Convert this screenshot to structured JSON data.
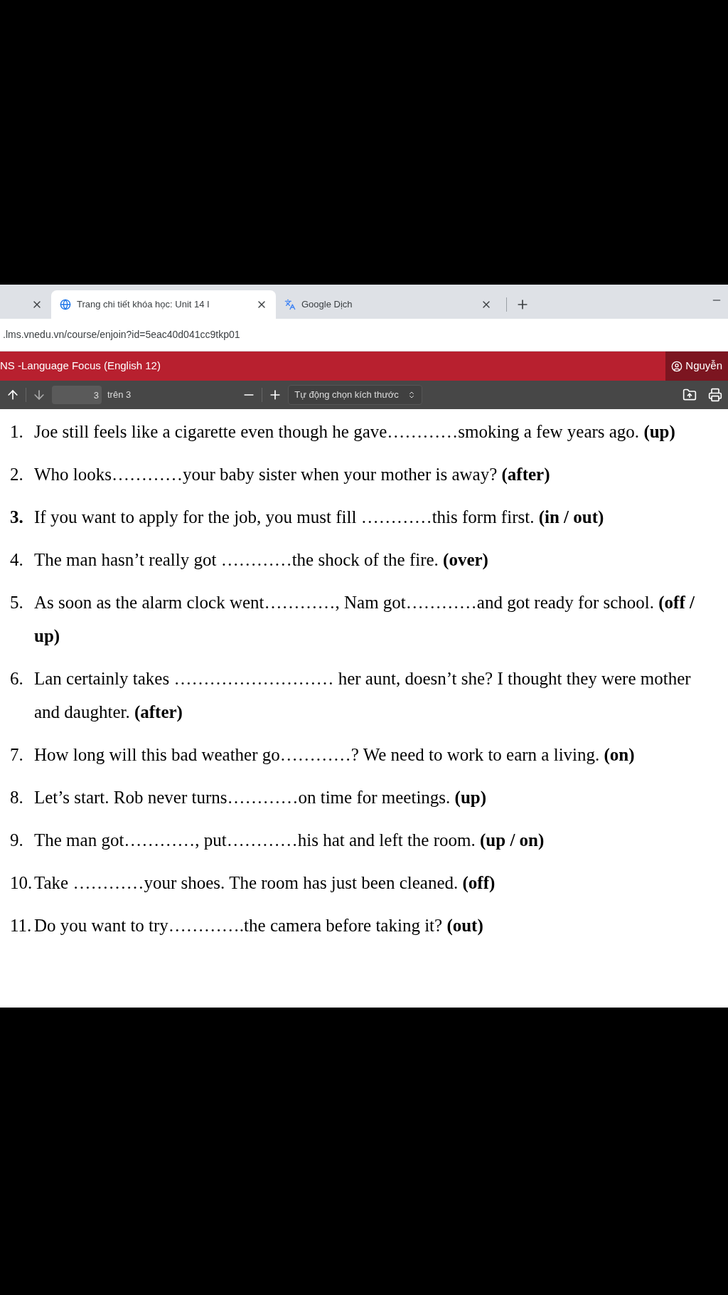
{
  "browser": {
    "tabs": [
      {
        "selected": false
      },
      {
        "title": "Trang chi tiết khóa học: Unit 14 I",
        "selected": true
      },
      {
        "title": "Google Dịch",
        "selected": false
      }
    ],
    "address": ".lms.vnedu.vn/course/enjoin?id=5eac40d041cc9tkp01"
  },
  "site_header": {
    "title": "NS -Language Focus (English 12)",
    "user": "Nguyễn"
  },
  "pdf_toolbar": {
    "page": "3",
    "page_count": "trên 3",
    "zoom": "Tự động chọn kích thước"
  },
  "exercises": [
    {
      "number": "1.",
      "number_bold": false,
      "text": "Joe still feels like a cigarette even though he gave…………smoking a few years ago. **(up)**"
    },
    {
      "number": "2.",
      "number_bold": false,
      "text": "Who looks…………your baby sister when your mother is away? **(after)**"
    },
    {
      "number": "3.",
      "number_bold": true,
      "text": "If you want to apply for the job, you must fill …………this form first. **(in / out)**"
    },
    {
      "number": "4.",
      "number_bold": false,
      "text": "The man hasn’t really got …………the shock of the fire. **(over)**"
    },
    {
      "number": "5.",
      "number_bold": false,
      "text": "As soon as the alarm clock went…………, Nam got…………and got ready for school. **(off / up)**"
    },
    {
      "number": "6.",
      "number_bold": false,
      "text": "Lan certainly takes ……………………… her aunt, doesn’t she? I thought they were mother and daughter. **(after)**"
    },
    {
      "number": "7.",
      "number_bold": false,
      "text": "How long will this bad weather go…………? We need to work to earn a living. **(on)**"
    },
    {
      "number": "8.",
      "number_bold": false,
      "text": "Let’s start. Rob never turns…………on time for meetings. **(up)**"
    },
    {
      "number": "9.",
      "number_bold": false,
      "text": "The man got…………, put…………his hat and left the room. **(up / on)**"
    },
    {
      "number": "10.",
      "number_bold": false,
      "text": "Take …………your shoes. The room has just been cleaned. **(off)**"
    },
    {
      "number": "11.",
      "number_bold": false,
      "text": "Do you want to try………….the camera before taking it? **(out)**"
    }
  ]
}
